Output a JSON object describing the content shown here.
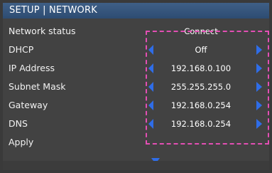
{
  "header": {
    "title": "SETUP | NETWORK"
  },
  "accent_color": "#2f6de8",
  "selection_color": "#e34fb4",
  "rows": [
    {
      "label": "Network status",
      "value": "Connect"
    },
    {
      "label": "DHCP",
      "value": "Off"
    },
    {
      "label": "IP Address",
      "value": "192.168.0.100"
    },
    {
      "label": "Subnet Mask",
      "value": "255.255.255.0"
    },
    {
      "label": "Gateway",
      "value": "192.168.0.254"
    },
    {
      "label": "DNS",
      "value": "192.168.0.254"
    },
    {
      "label": "Apply"
    }
  ],
  "icons": {
    "left": "triangle-left-icon",
    "right": "triangle-right-icon",
    "apply": "triangle-down-icon"
  }
}
